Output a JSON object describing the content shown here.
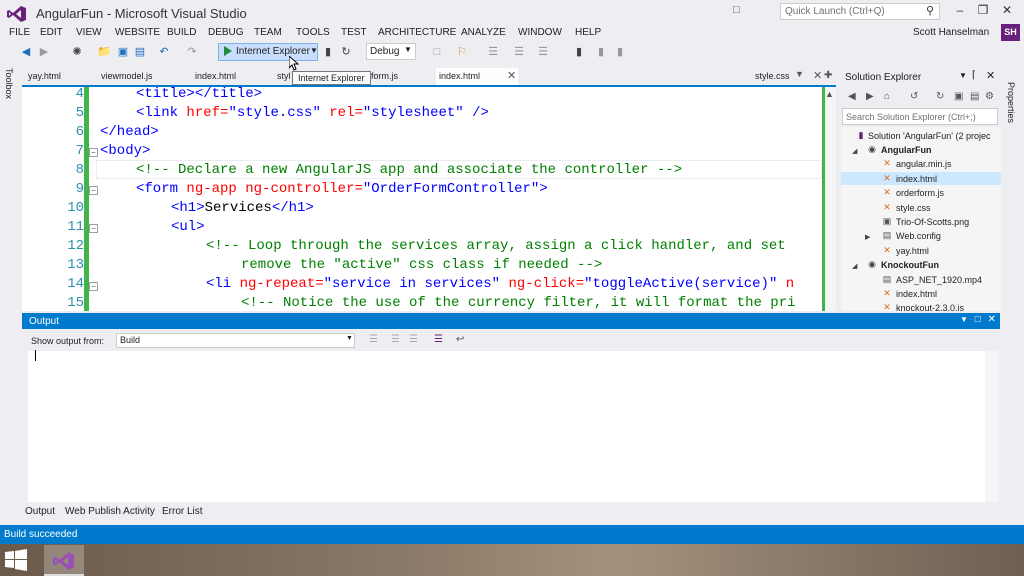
{
  "window": {
    "title": "AngularFun - Microsoft Visual Studio",
    "quick_launch_placeholder": "Quick Launch (Ctrl+Q)",
    "controls": [
      "–",
      "❐",
      "✕"
    ]
  },
  "menu": {
    "items": [
      "FILE",
      "EDIT",
      "VIEW",
      "WEBSITE",
      "BUILD",
      "DEBUG",
      "TEAM",
      "TOOLS",
      "TEST",
      "ARCHITECTURE",
      "ANALYZE",
      "WINDOW",
      "HELP"
    ],
    "user_name": "Scott Hanselman",
    "user_initials": "SH"
  },
  "toolbar": {
    "run_target": "Internet Explorer",
    "configuration": "Debug",
    "tooltip": "Internet Explorer"
  },
  "side_panels": {
    "left": "Toolbox",
    "right": "Properties"
  },
  "editor": {
    "tabs": [
      {
        "label": "yay.html",
        "active": false
      },
      {
        "label": "viewmodel.js",
        "active": false
      },
      {
        "label": "index.html",
        "active": false
      },
      {
        "label": "styl",
        "active": false
      },
      {
        "label": "form.js",
        "active": false
      },
      {
        "label": "index.html",
        "active": true
      },
      {
        "label": "style.css",
        "active": false
      }
    ],
    "line_numbers": [
      "4",
      "5",
      "6",
      "7",
      "8",
      "9",
      "10",
      "11",
      "12",
      "13",
      "14",
      "15"
    ],
    "code": {
      "l4_open": "<title>",
      "l4_close": "</title>",
      "l5_tag": "<link",
      "l5_attr1": "href=",
      "l5_val1": "\"style.css\"",
      "l5_attr2": "rel=",
      "l5_val2": "\"stylesheet\"",
      "l5_end": "/>",
      "l6": "</head>",
      "l7": "<body>",
      "l8": "<!-- Declare a new AngularJS app and associate the controller -->",
      "l9_tag": "<form",
      "l9_attr1": "ng-app",
      "l9_attr2": "ng-controller=",
      "l9_val": "\"OrderFormController\"",
      "l9_end": ">",
      "l10_open": "<h1>",
      "l10_text": "Services",
      "l10_close": "</h1>",
      "l11": "<ul>",
      "l12": "<!-- Loop through the services array, assign a click handler, and set",
      "l13": "remove the \"active\" css class if needed -->",
      "l14_tag": "<li",
      "l14_attr1": "ng-repeat=",
      "l14_val1": "\"service in services\"",
      "l14_attr2": "ng-click=",
      "l14_val2": "\"toggleActive(service)\"",
      "l14_attr3": "n",
      "l15": "<!-- Notice the use of the currency filter, it will format the pri"
    }
  },
  "solution_explorer": {
    "title": "Solution Explorer",
    "search_placeholder": "Search Solution Explorer (Ctrl+;)",
    "tree": [
      {
        "label": "Solution 'AngularFun' (2 projec",
        "bold": false
      },
      {
        "label": "AngularFun",
        "bold": true
      },
      {
        "label": "angular.min.js",
        "bold": false
      },
      {
        "label": "index.html",
        "bold": false
      },
      {
        "label": "orderform.js",
        "bold": false
      },
      {
        "label": "style.css",
        "bold": false
      },
      {
        "label": "Trio-Of-Scotts.png",
        "bold": false
      },
      {
        "label": "Web.config",
        "bold": false
      },
      {
        "label": "yay.html",
        "bold": false
      },
      {
        "label": "KnockoutFun",
        "bold": true
      },
      {
        "label": "ASP_NET_1920.mp4",
        "bold": false
      },
      {
        "label": "index.html",
        "bold": false
      },
      {
        "label": "knockout-2.3.0.js",
        "bold": false
      }
    ]
  },
  "output": {
    "title": "Output",
    "source_label": "Show output from:",
    "source_value": "Build"
  },
  "bottom_tabs": [
    "Output",
    "Web Publish Activity",
    "Error List"
  ],
  "status": {
    "text": "Build succeeded"
  },
  "colors": {
    "accent": "#007acc",
    "vs_purple": "#68217a",
    "change_bar": "#41b549"
  }
}
